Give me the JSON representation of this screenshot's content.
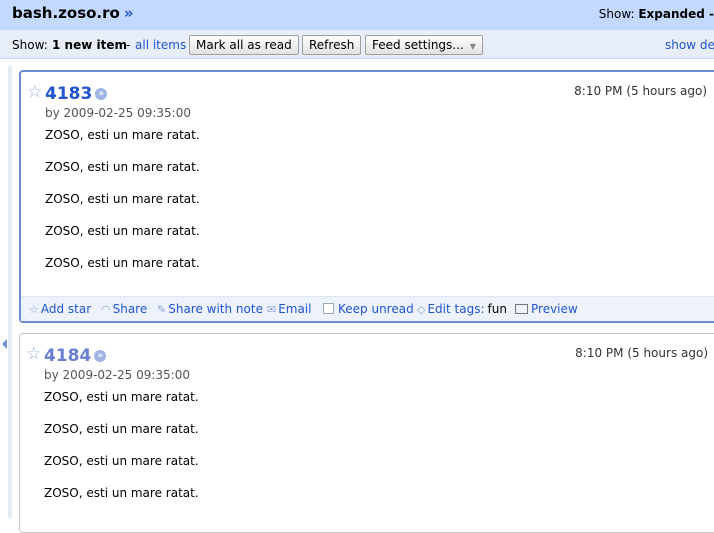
{
  "header": {
    "feed_title": "bash.zoso.ro",
    "feed_title_arrow": "»",
    "show_label": "Show:",
    "show_value": "Expanded -"
  },
  "toolbar": {
    "show_label": "Show:",
    "new_items": "1 new item",
    "separator": "-",
    "all_items": "all items",
    "mark_all_read": "Mark all as read",
    "refresh": "Refresh",
    "feed_settings": "Feed settings...",
    "show_details": "show det"
  },
  "entries": [
    {
      "title": "4183",
      "date": "8:10 PM (5 hours ago)",
      "author": "by 2009-02-25 09:35:00",
      "lines": [
        "ZOSO, esti un mare ratat.",
        "ZOSO, esti un mare ratat.",
        "ZOSO, esti un mare ratat.",
        "ZOSO, esti un mare ratat.",
        "ZOSO, esti un mare ratat."
      ],
      "actions": {
        "add_star": "Add star",
        "share": "Share",
        "share_with_note": "Share with note",
        "email": "Email",
        "keep_unread": "Keep unread",
        "edit_tags": "Edit tags:",
        "tag": "fun",
        "preview": "Preview"
      }
    },
    {
      "title": "4184",
      "date": "8:10 PM (5 hours ago)",
      "author": "by 2009-02-25 09:35:00",
      "lines": [
        "ZOSO, esti un mare ratat.",
        "ZOSO, esti un mare ratat.",
        "ZOSO, esti un mare ratat.",
        "ZOSO, esti un mare ratat."
      ]
    }
  ],
  "icons": {
    "star": "star-icon",
    "more": "chevron-right-icon",
    "share": "share-icon",
    "share_note": "note-icon",
    "email": "mail-icon",
    "tag": "tag-icon",
    "preview": "preview-icon"
  },
  "colors": {
    "topbar": "#c3d9ff",
    "toolbar": "#e8eef7",
    "link": "#2255cc",
    "current_border": "#6a8cd3"
  }
}
